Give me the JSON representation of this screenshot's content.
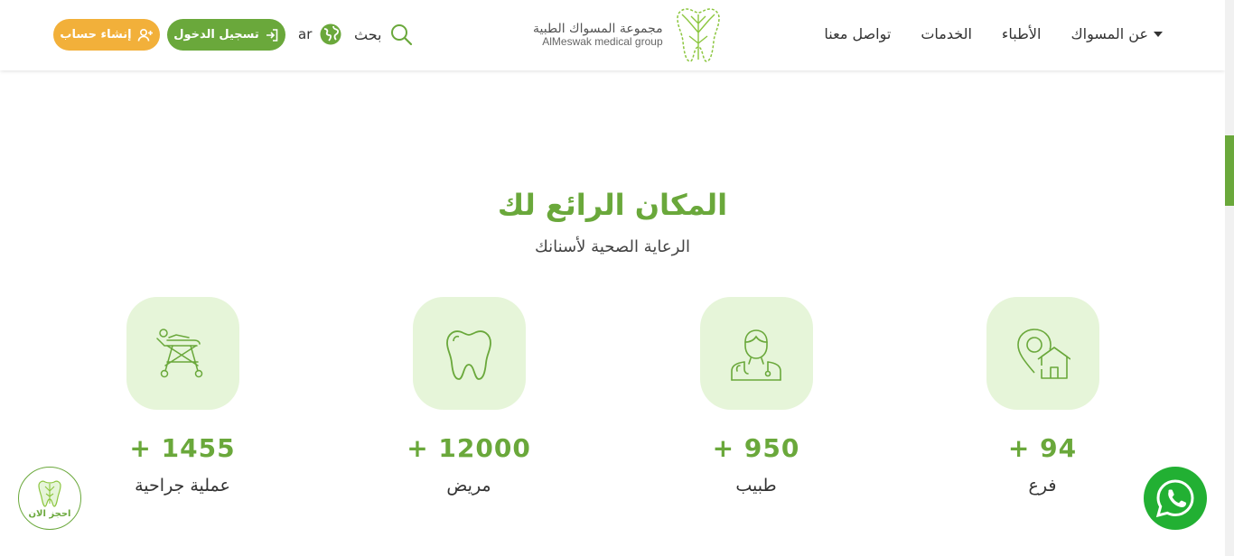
{
  "header": {
    "register_label": "إنشاء حساب",
    "login_label": "تسجيل الدخول",
    "language": "ar",
    "search_label": "بحث",
    "logo": {
      "name_ar": "مجموعة المسواك الطبية",
      "name_en": "AlMeswak medical group"
    },
    "nav": [
      {
        "label": "عن المسواك",
        "has_dropdown": true
      },
      {
        "label": "الأطباء",
        "has_dropdown": false
      },
      {
        "label": "الخدمات",
        "has_dropdown": false
      },
      {
        "label": "تواصل معنا",
        "has_dropdown": false
      }
    ]
  },
  "section": {
    "title": "المكان الرائع لك",
    "subtitle": "الرعاية الصحية لأسنانك"
  },
  "stats": [
    {
      "value": "+ 1455",
      "label": "عملية جراحية",
      "icon": "stretcher-icon"
    },
    {
      "value": "+ 12000",
      "label": "مريض",
      "icon": "tooth-icon"
    },
    {
      "value": "+ 950",
      "label": "طبيب",
      "icon": "doctor-icon"
    },
    {
      "value": "+ 94",
      "label": "فرع",
      "icon": "location-home-icon"
    }
  ],
  "floating": {
    "book_label": "احجز الان"
  },
  "colors": {
    "brand_green": "#6aa83b",
    "brand_orange": "#f2b03a",
    "icon_bg": "#e6f5d9",
    "whatsapp": "#22b033"
  }
}
